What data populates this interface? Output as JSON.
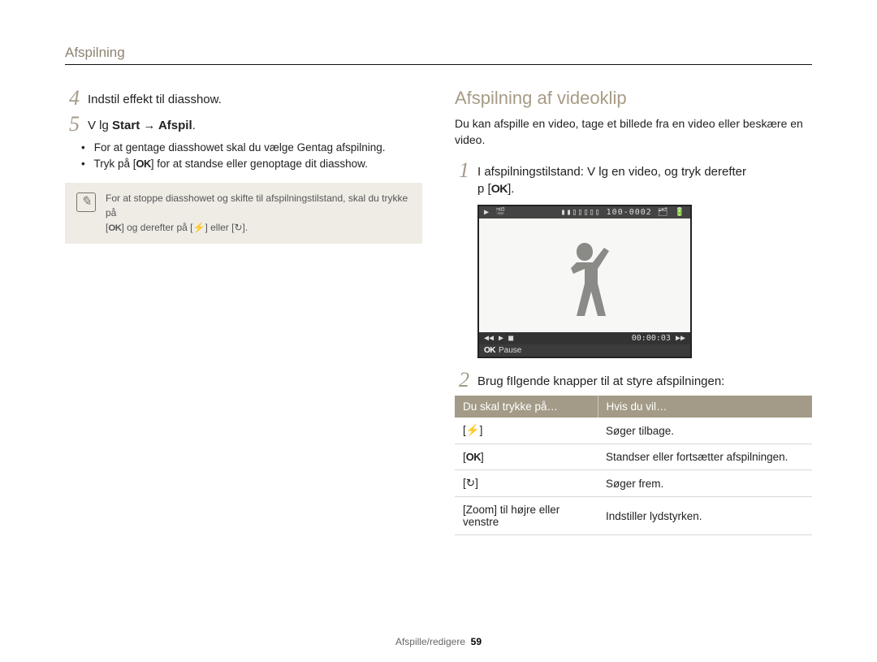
{
  "header": {
    "title": "Afspilning"
  },
  "left": {
    "step4": {
      "text": "Indstil effekt til diasshow."
    },
    "step5": {
      "prefix": "V lg ",
      "bold": "Start → Afspil",
      "suffix": "."
    },
    "bullets": [
      {
        "pre": "For at gentage diasshowet skal du vælge ",
        "bold": "Gentag afspilning",
        "post": "."
      },
      {
        "pre": "Tryk på [",
        "ok": "OK",
        "post": "] for at standse eller genoptage dit diasshow."
      }
    ],
    "note": {
      "line1_pre": "For at stoppe diasshowet og skifte til afspilningstilstand, skal du trykke på",
      "line2_pre": "[",
      "line2_ok": "OK",
      "line2_mid": "] og derefter på [",
      "icon_left": "⚡",
      "line2_mid2": "] eller [",
      "icon_right": "↻",
      "line2_end": "]."
    }
  },
  "right": {
    "heading": "Afspilning af videoklip",
    "intro": "Du kan afspille en video, tage et billede fra en video eller beskære en video.",
    "step1": {
      "line1": "I afspilningstilstand: V lg en video, og tryk derefter",
      "line2_prefix": "p   [",
      "line2_ok": "OK",
      "line2_suffix": "]."
    },
    "preview": {
      "top_left_icons": "▶  🎬",
      "top_right": "▮▮▯▯▯▯▯ 100-0002  🗂  🔋",
      "controls_left": "◀◀  ▶  ■",
      "controls_right": "00:00:03  ▶▶",
      "caption_ok": "OK",
      "caption_text": "Pause"
    },
    "step2": {
      "text": "Brug fIlgende knapper til at styre afspilningen:"
    },
    "table": {
      "header": [
        "Du skal trykke på…",
        "Hvis du vil…"
      ],
      "rows": [
        {
          "left_pre": "[",
          "left_icon": "⚡",
          "left_post": "]",
          "right": "Søger tilbage."
        },
        {
          "left_pre": "[",
          "left_ok": "OK",
          "left_post": "]",
          "right": "Standser eller fortsætter afspilningen."
        },
        {
          "left_pre": "[",
          "left_icon": "↻",
          "left_post": "]",
          "right": "Søger frem."
        },
        {
          "left_pre": "[",
          "left_bold": "Zoom",
          "left_post": "] til højre eller venstre",
          "right": "Indstiller lydstyrken."
        }
      ]
    }
  },
  "footer": {
    "section": "Afspille/redigere",
    "page": "59"
  }
}
